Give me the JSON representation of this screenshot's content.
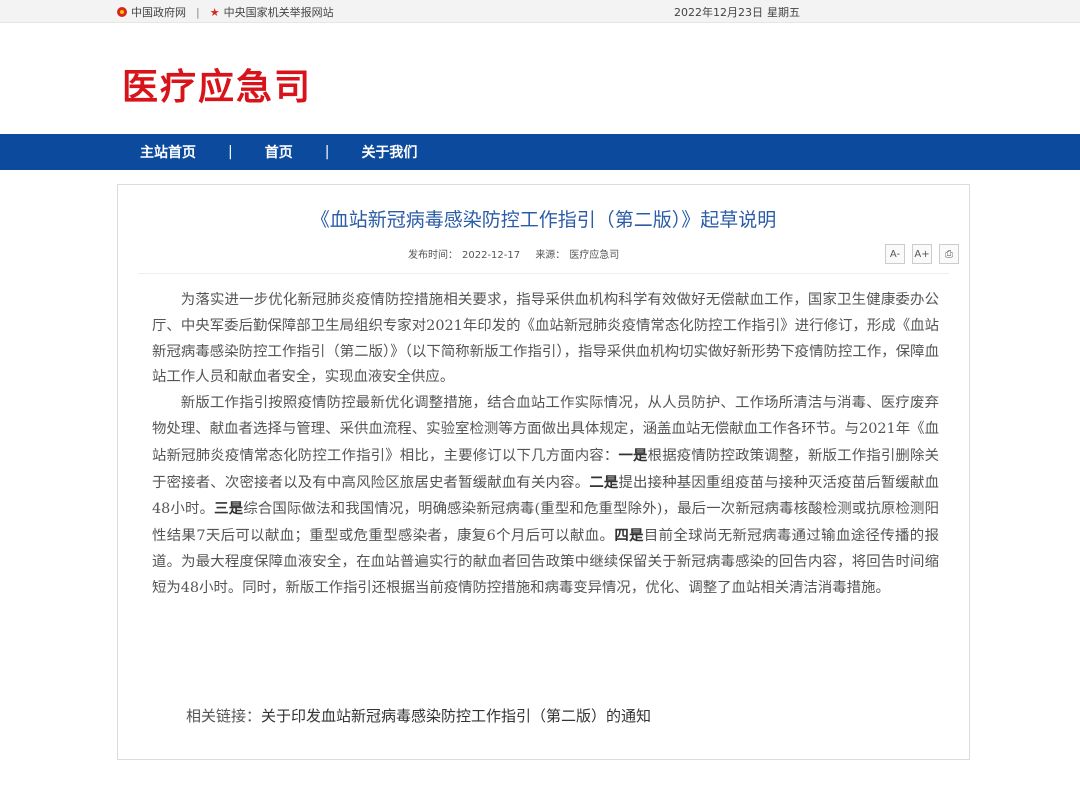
{
  "topbar": {
    "link1": "中国政府网",
    "separator": "|",
    "link2": "中央国家机关举报网站",
    "date": "2022年12月23日",
    "weekday": "星期五"
  },
  "header": {
    "site_title": "医疗应急司"
  },
  "nav": {
    "items": [
      {
        "label": "主站首页"
      },
      {
        "label": "首页"
      },
      {
        "label": "关于我们"
      }
    ],
    "divider": "|"
  },
  "article": {
    "title": "《血站新冠病毒感染防控工作指引（第二版）》起草说明",
    "publish_label": "发布时间：",
    "publish_date": "2022-12-17",
    "source_label": "来源：",
    "source": "医疗应急司",
    "tools": {
      "font_small": "A-",
      "font_large": "A+",
      "print": "⎙"
    },
    "para1": "为落实进一步优化新冠肺炎疫情防控措施相关要求，指导采供血机构科学有效做好无偿献血工作，国家卫生健康委办公厅、中央军委后勤保障部卫生局组织专家对2021年印发的《血站新冠肺炎疫情常态化防控工作指引》进行修订，形成《血站新冠病毒感染防控工作指引（第二版）》（以下简称新版工作指引），指导采供血机构切实做好新形势下疫情防控工作，保障血站工作人员和献血者安全，实现血液安全供应。",
    "para2_a": "新版工作指引按照疫情防控最新优化调整措施，结合血站工作实际情况，从人员防护、工作场所清洁与消毒、医疗废弃物处理、献血者选择与管理、采供血流程、实验室检测等方面做出具体规定，涵盖血站无偿献血工作各环节。与2021年《血站新冠肺炎疫情常态化防控工作指引》相比，主要修订以下几方面内容：",
    "kw1": "一是",
    "para2_b": "根据疫情防控政策调整，新版工作指引删除关于密接者、次密接者以及有中高风险区旅居史者暂缓献血有关内容。",
    "kw2": "二是",
    "para2_c": "提出接种基因重组疫苗与接种灭活疫苗后暂缓献血48小时。",
    "kw3": "三是",
    "para2_d": "综合国际做法和我国情况，明确感染新冠病毒(重型和危重型除外)，最后一次新冠病毒核酸检测或抗原检测阳性结果7天后可以献血；重型或危重型感染者，康复6个月后可以献血。",
    "kw4": "四是",
    "para2_e": "目前全球尚无新冠病毒通过输血途径传播的报道。为最大程度保障血液安全，在血站普遍实行的献血者回告政策中继续保留关于新冠病毒感染的回告内容，将回告时间缩短为48小时。同时，新版工作指引还根据当前疫情防控措施和病毒变异情况，优化、调整了血站相关清洁消毒措施。",
    "related_label": "相关链接：",
    "related_link": "关于印发血站新冠病毒感染防控工作指引（第二版）的通知"
  }
}
